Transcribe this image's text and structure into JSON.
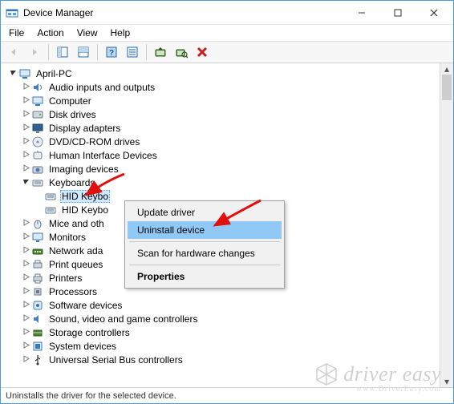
{
  "title": "Device Manager",
  "menu": [
    "File",
    "Action",
    "View",
    "Help"
  ],
  "status": "Uninstalls the driver for the selected device.",
  "root": "April-PC",
  "categories": [
    {
      "label": "Audio inputs and outputs",
      "icon": "audio"
    },
    {
      "label": "Computer",
      "icon": "computer"
    },
    {
      "label": "Disk drives",
      "icon": "disk"
    },
    {
      "label": "Display adapters",
      "icon": "display"
    },
    {
      "label": "DVD/CD-ROM drives",
      "icon": "dvd"
    },
    {
      "label": "Human Interface Devices",
      "icon": "hid"
    },
    {
      "label": "Imaging devices",
      "icon": "camera"
    },
    {
      "label": "Keyboards",
      "icon": "keyboard",
      "expanded": true,
      "children": [
        {
          "label": "HID Keybo",
          "icon": "keyboard",
          "selected": true
        },
        {
          "label": "HID Keybo",
          "icon": "keyboard"
        }
      ]
    },
    {
      "label": "Mice and oth",
      "icon": "mouse"
    },
    {
      "label": "Monitors",
      "icon": "monitor"
    },
    {
      "label": "Network ada",
      "icon": "network"
    },
    {
      "label": "Print queues",
      "icon": "printq"
    },
    {
      "label": "Printers",
      "icon": "printer"
    },
    {
      "label": "Processors",
      "icon": "cpu"
    },
    {
      "label": "Software devices",
      "icon": "soft"
    },
    {
      "label": "Sound, video and game controllers",
      "icon": "sound"
    },
    {
      "label": "Storage controllers",
      "icon": "storage"
    },
    {
      "label": "System devices",
      "icon": "system"
    },
    {
      "label": "Universal Serial Bus controllers",
      "icon": "usb"
    }
  ],
  "context": {
    "items": [
      {
        "label": "Update driver"
      },
      {
        "label": "Uninstall device",
        "hl": true
      },
      {
        "sep": true
      },
      {
        "label": "Scan for hardware changes"
      },
      {
        "sep": true
      },
      {
        "label": "Properties",
        "bold": true
      }
    ]
  },
  "watermark": "driver easy",
  "watermark_url": "www.DriverEasy.com"
}
